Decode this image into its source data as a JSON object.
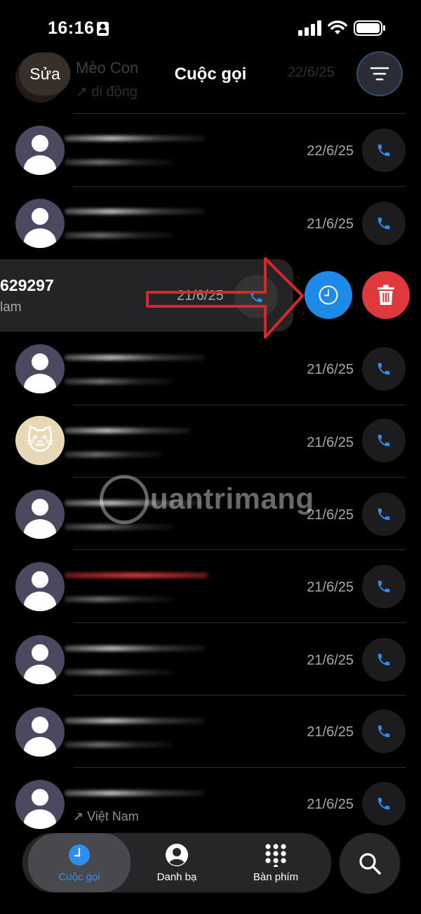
{
  "status_bar": {
    "time": "16:16"
  },
  "background_row": {
    "name": "Mèo Con",
    "subtitle": "↗ di động",
    "date": "22/6/25"
  },
  "header": {
    "edit_label": "Sửa",
    "title": "Cuộc gọi"
  },
  "calls": [
    {
      "date": "22/6/25",
      "avatar": "person",
      "name_hidden": true
    },
    {
      "date": "21/6/25",
      "avatar": "person",
      "name_hidden": true
    },
    {
      "date": "21/6/25",
      "avatar": "person",
      "name_hidden": true
    },
    {
      "date": "21/6/25",
      "avatar": "cat",
      "name_hidden": true
    },
    {
      "date": "21/6/25",
      "avatar": "person",
      "name_hidden": true
    },
    {
      "date": "21/6/25",
      "avatar": "person",
      "name_hidden": true,
      "highlight_color": "#d03a3a"
    },
    {
      "date": "21/6/25",
      "avatar": "person",
      "name_hidden": true
    },
    {
      "date": "21/6/25",
      "avatar": "person",
      "name_hidden": true
    },
    {
      "date": "21/6/25",
      "avatar": "person",
      "name_hidden": true,
      "subtitle": "↗ Việt Nam"
    }
  ],
  "swiped_row": {
    "number": "629297",
    "subtitle": "lam",
    "date": "21/6/25",
    "actions": {
      "history": "clock-icon",
      "delete": "trash-icon"
    }
  },
  "annotation": {
    "type": "arrow",
    "color": "#d9262b",
    "points_to": "history-action-button"
  },
  "watermark": {
    "text": "uantrimang"
  },
  "tab_bar": {
    "tabs": [
      {
        "label": "Cuộc gọi",
        "icon": "clock-icon",
        "active": true
      },
      {
        "label": "Danh bạ",
        "icon": "person-circle-icon",
        "active": false
      },
      {
        "label": "Bàn phím",
        "icon": "keypad-icon",
        "active": false
      }
    ],
    "search_icon": "search-icon"
  },
  "colors": {
    "accent": "#2d8ef0",
    "delete": "#e0393d",
    "history": "#1e8ae8",
    "background": "#000000"
  }
}
